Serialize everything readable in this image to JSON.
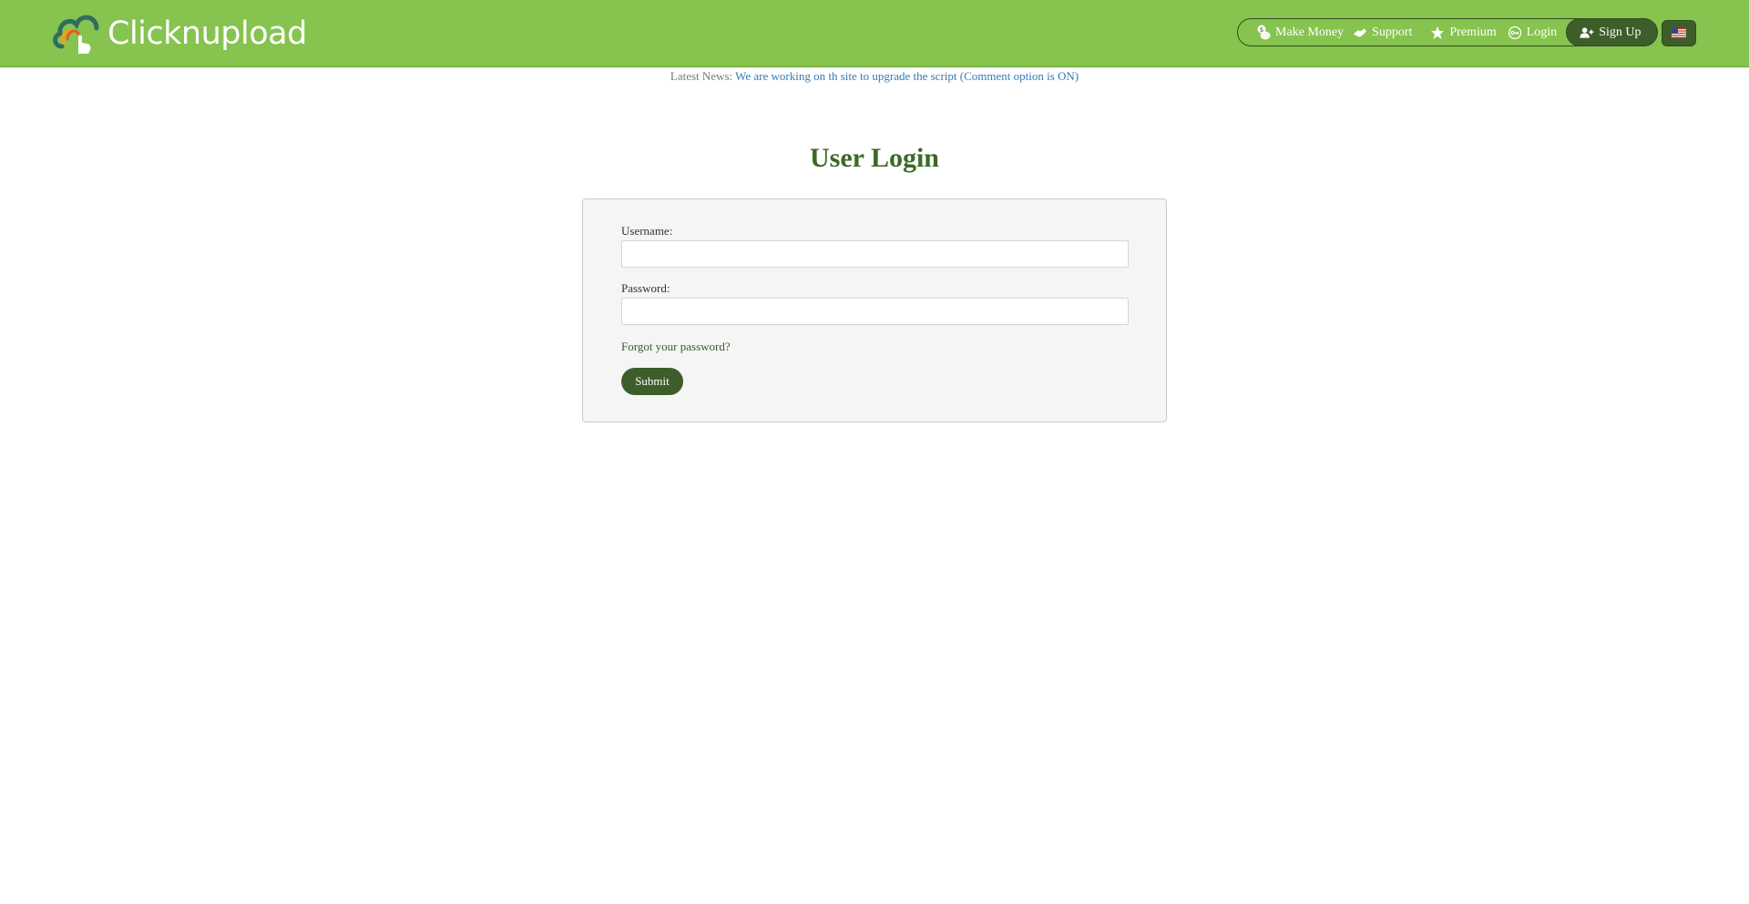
{
  "header": {
    "logo_text": "Clicknupload",
    "nav": {
      "make_money": "Make Money",
      "support": "Support",
      "premium": "Premium",
      "login": "Login",
      "signup": "Sign Up"
    },
    "language_flag": "us-flag-icon"
  },
  "news": {
    "label": "Latest News:",
    "link_text": "We are working on th site to upgrade the script (Comment option is ON)"
  },
  "main": {
    "title": "User Login",
    "form": {
      "username_label": "Username:",
      "username_value": "",
      "password_label": "Password:",
      "password_value": "",
      "forgot_text": "Forgot your password?",
      "submit_label": "Submit"
    }
  },
  "colors": {
    "header_bg": "#86c34f",
    "accent_dark": "#3d5e2a",
    "title": "#3b6a27",
    "link": "#337ab7"
  }
}
